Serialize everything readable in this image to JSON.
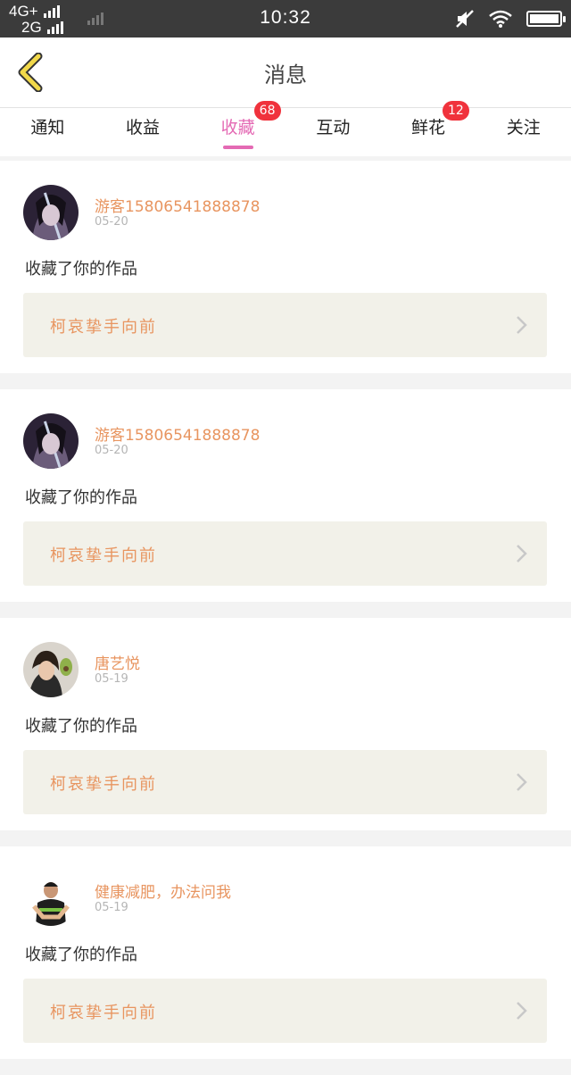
{
  "status_bar": {
    "network_top": "4G+",
    "network_bottom": "2G",
    "time": "10:32"
  },
  "header": {
    "title": "消息"
  },
  "tabs": [
    {
      "label": "通知",
      "badge": ""
    },
    {
      "label": "收益",
      "badge": ""
    },
    {
      "label": "收藏",
      "badge": "68",
      "active": true
    },
    {
      "label": "互动",
      "badge": ""
    },
    {
      "label": "鲜花",
      "badge": "12"
    },
    {
      "label": "关注",
      "badge": ""
    }
  ],
  "messages": [
    {
      "user": "游客15806541888878",
      "date": "05-20",
      "action": "收藏了你的作品",
      "work": "柯哀挚手向前"
    },
    {
      "user": "游客15806541888878",
      "date": "05-20",
      "action": "收藏了你的作品",
      "work": "柯哀挚手向前"
    },
    {
      "user": "唐艺悦",
      "date": "05-19",
      "action": "收藏了你的作品",
      "work": "柯哀挚手向前"
    },
    {
      "user": "健康减肥，办法问我",
      "date": "05-19",
      "action": "收藏了你的作品",
      "work": "柯哀挚手向前"
    }
  ],
  "colors": {
    "accent": "#e46ab4",
    "badge": "#f0323c",
    "username": "#e89560",
    "back_arrow": "#f2d94a"
  }
}
